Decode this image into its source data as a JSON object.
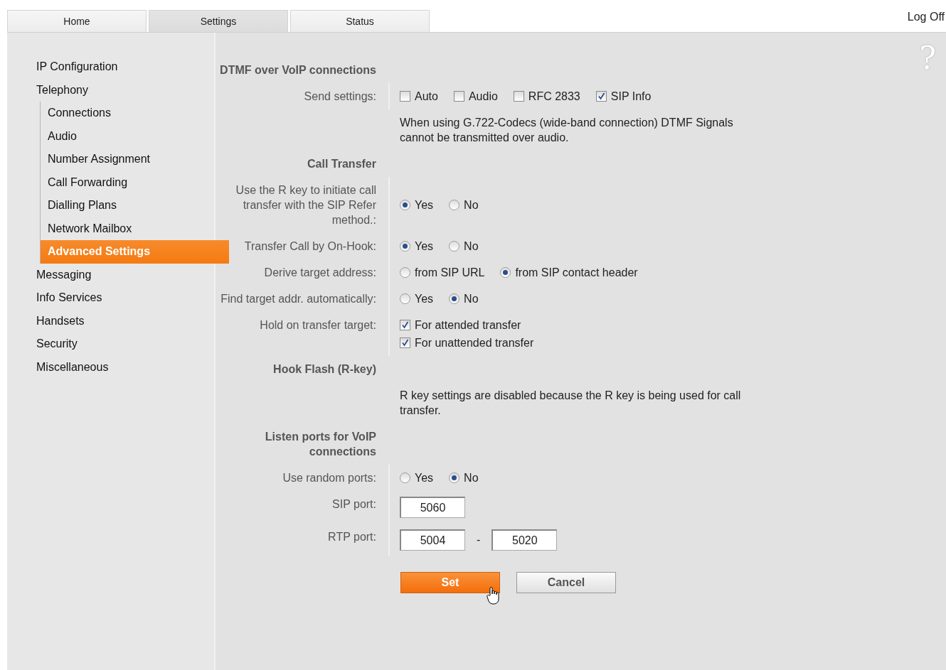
{
  "tabs": [
    {
      "label": "Home",
      "selected": false
    },
    {
      "label": "Settings",
      "selected": true
    },
    {
      "label": "Status",
      "selected": false
    }
  ],
  "log_off": "Log Off",
  "help": "?",
  "sidebar": {
    "items": [
      {
        "label": "IP Configuration",
        "selected": false
      },
      {
        "label": "Telephony",
        "selected": false,
        "children": [
          {
            "label": "Connections",
            "selected": false
          },
          {
            "label": "Audio",
            "selected": false
          },
          {
            "label": "Number Assignment",
            "selected": false
          },
          {
            "label": "Call Forwarding",
            "selected": false
          },
          {
            "label": "Dialling Plans",
            "selected": false
          },
          {
            "label": "Network Mailbox",
            "selected": false
          },
          {
            "label": "Advanced Settings",
            "selected": true
          }
        ]
      },
      {
        "label": "Messaging",
        "selected": false
      },
      {
        "label": "Info Services",
        "selected": false
      },
      {
        "label": "Handsets",
        "selected": false
      },
      {
        "label": "Security",
        "selected": false
      },
      {
        "label": "Miscellaneous",
        "selected": false
      }
    ]
  },
  "form": [
    {
      "kind": "heading",
      "label": "DTMF over VoIP connections"
    },
    {
      "kind": "checkboxes",
      "label": "Send settings:",
      "options": [
        {
          "label": "Auto",
          "checked": false
        },
        {
          "label": "Audio",
          "checked": false
        },
        {
          "label": "RFC 2833",
          "checked": false
        },
        {
          "label": "SIP Info",
          "checked": true
        }
      ]
    },
    {
      "kind": "note",
      "text": "When using G.722-Codecs (wide-band connection) DTMF Signals cannot be transmitted over audio."
    },
    {
      "kind": "heading",
      "label": "Call Transfer"
    },
    {
      "kind": "radios",
      "label": "Use the R key to initiate call transfer with the SIP Refer method.:",
      "options": [
        {
          "label": "Yes",
          "selected": true
        },
        {
          "label": "No",
          "selected": false
        }
      ]
    },
    {
      "kind": "radios",
      "label": "Transfer Call by On-Hook:",
      "options": [
        {
          "label": "Yes",
          "selected": true
        },
        {
          "label": "No",
          "selected": false
        }
      ]
    },
    {
      "kind": "radios",
      "label": "Derive target address:",
      "options": [
        {
          "label": "from SIP URL",
          "selected": false
        },
        {
          "label": "from SIP contact header",
          "selected": true
        }
      ]
    },
    {
      "kind": "radios",
      "label": "Find target addr. automatically:",
      "options": [
        {
          "label": "Yes",
          "selected": false
        },
        {
          "label": "No",
          "selected": true
        }
      ]
    },
    {
      "kind": "checklist",
      "label": "Hold on transfer target:",
      "options": [
        {
          "label": "For attended transfer",
          "checked": true
        },
        {
          "label": "For unattended transfer",
          "checked": true
        }
      ]
    },
    {
      "kind": "heading",
      "label": "Hook Flash (R-key)"
    },
    {
      "kind": "note",
      "text": "R key settings are disabled because the R key is being used for call transfer."
    },
    {
      "kind": "heading",
      "label": "Listen ports for VoIP connections"
    },
    {
      "kind": "radios",
      "label": "Use random ports:",
      "options": [
        {
          "label": "Yes",
          "selected": false
        },
        {
          "label": "No",
          "selected": true
        }
      ]
    },
    {
      "kind": "inputs",
      "label": "SIP port:",
      "values": [
        "5060"
      ]
    },
    {
      "kind": "range",
      "label": "RTP port:",
      "values": [
        "5004",
        "5020"
      ],
      "separator": "-"
    }
  ],
  "buttons": [
    {
      "label": "Set",
      "kind": "primary"
    },
    {
      "label": "Cancel",
      "kind": "secondary"
    }
  ]
}
